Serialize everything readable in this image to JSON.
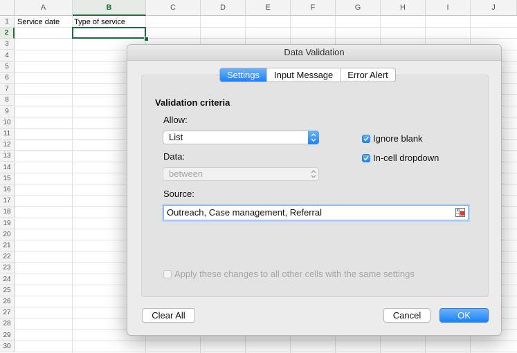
{
  "sheet": {
    "columns": [
      "A",
      "B",
      "C",
      "D",
      "E",
      "F",
      "G",
      "H",
      "I",
      "J"
    ],
    "selected_column": "B",
    "rows": [
      "1",
      "2",
      "3",
      "4",
      "5",
      "6",
      "7",
      "8",
      "9",
      "10",
      "11",
      "12",
      "13",
      "14",
      "15",
      "16",
      "17",
      "18",
      "19",
      "20",
      "21",
      "22",
      "23",
      "24",
      "25",
      "26",
      "27",
      "28",
      "29",
      "30"
    ],
    "selected_row": "2",
    "cells": {
      "A1": "Service date",
      "B1": "Type of service"
    }
  },
  "dialog": {
    "title": "Data Validation",
    "tabs": [
      "Settings",
      "Input Message",
      "Error Alert"
    ],
    "active_tab": "Settings",
    "section_title": "Validation criteria",
    "allow_label": "Allow:",
    "allow_value": "List",
    "data_label": "Data:",
    "data_value": "between",
    "source_label": "Source:",
    "source_value": "Outreach, Case management, Referral",
    "ignore_blank_label": "Ignore blank",
    "ignore_blank_checked": true,
    "in_cell_dropdown_label": "In-cell dropdown",
    "in_cell_dropdown_checked": true,
    "apply_all_label": "Apply these changes to all other cells with the same settings",
    "apply_all_checked": false,
    "clear_all_label": "Clear All",
    "cancel_label": "Cancel",
    "ok_label": "OK"
  },
  "icons": {
    "chevron": "chevron-updown-icon",
    "checkmark": "checkmark-icon",
    "range_picker": "range-selector-icon"
  },
  "colors": {
    "accent": "#1a82fb",
    "selection_green": "#1d6b38"
  }
}
